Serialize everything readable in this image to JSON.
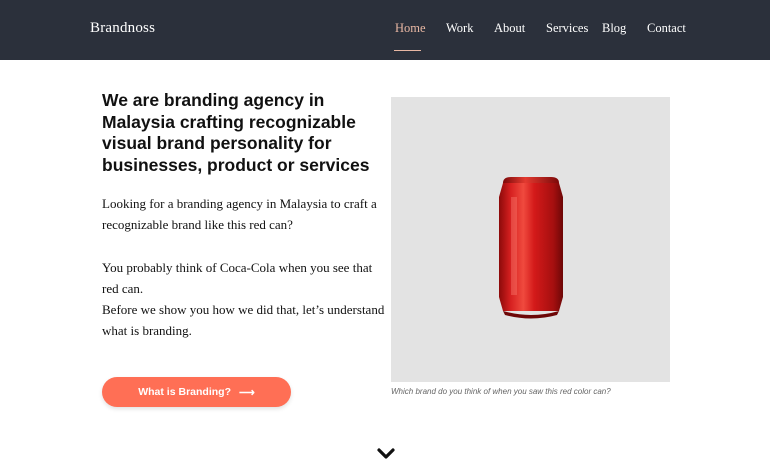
{
  "nav": {
    "brand": "Brandnoss",
    "links": [
      "Home",
      "Work",
      "About",
      "Services",
      "Blog",
      "Contact"
    ],
    "active": "Home"
  },
  "hero": {
    "headline": "We are branding agency in Malaysia crafting recognizable visual brand personality for businesses, product or services",
    "paragraphs": [
      "Looking for a branding agency in Malaysia to craft a recognizable brand like this red can?",
      "You probably think of Coca-Cola when you see that red can.",
      "Before we show you how we did that, let’s understand what is branding."
    ],
    "cta_label": "What is Branding?",
    "cta_icon": "arrow-right-icon"
  },
  "media": {
    "image_subject": "red-can",
    "caption": "Which brand do you think of when you saw this red color can?"
  },
  "colors": {
    "navbar": "#2b303b",
    "nav_active": "#e8b7a3",
    "cta": "#ff6f55",
    "image_bg": "#e3e3e3",
    "can_red": "#d41a1a"
  },
  "scroll": {
    "icon": "chevron-down-icon"
  }
}
